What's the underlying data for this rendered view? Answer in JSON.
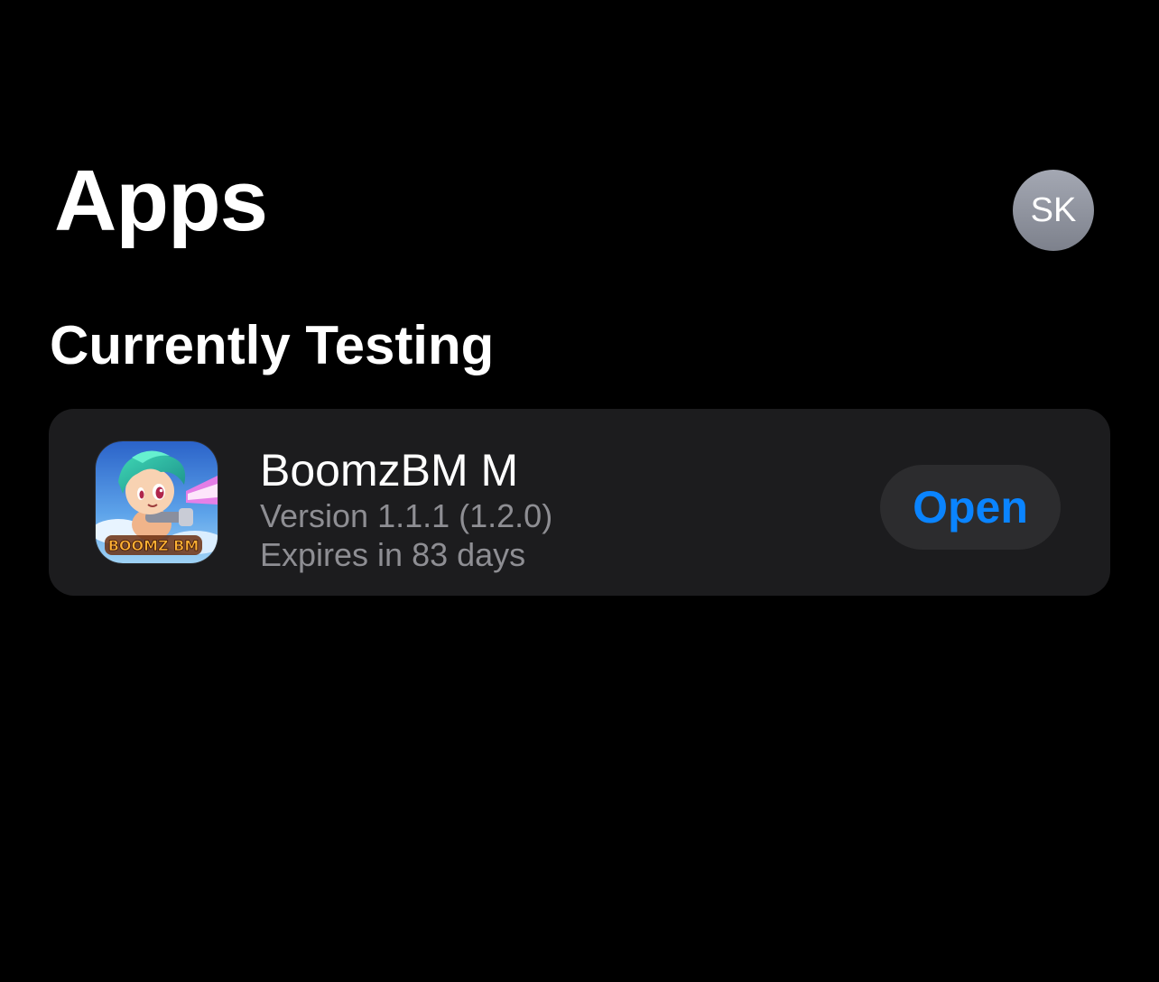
{
  "header": {
    "title": "Apps",
    "avatar_initials": "SK"
  },
  "section": {
    "title": "Currently Testing"
  },
  "apps": [
    {
      "name": "BoomzBM M",
      "version": "Version 1.1.1 (1.2.0)",
      "expiry": "Expires in 83 days",
      "action_label": "Open",
      "icon": "boomz-bm-app-icon",
      "icon_text": "BOOMZ BM"
    }
  ],
  "colors": {
    "background": "#000000",
    "card": "#1c1c1e",
    "accent": "#0a84ff",
    "secondary_text": "#8e8e93",
    "button_background": "#2c2c2e"
  }
}
